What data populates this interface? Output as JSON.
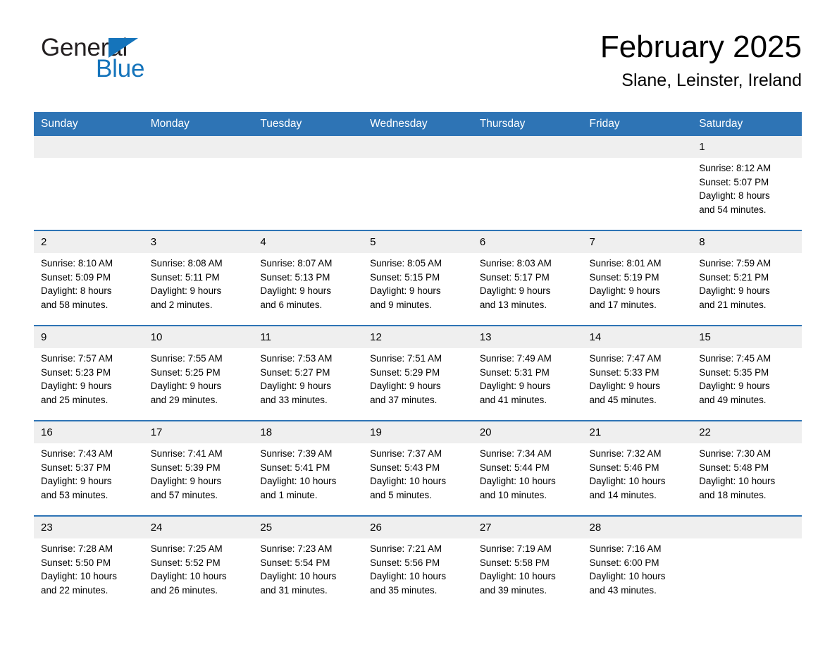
{
  "logo": {
    "word_one": "General",
    "word_two": "Blue",
    "triangle_icon": "triangle-right-icon",
    "black_color": "#231f20",
    "blue_color": "#1574bb"
  },
  "header": {
    "title": "February 2025",
    "subtitle": "Slane, Leinster, Ireland"
  },
  "theme": {
    "header_blue": "#2e74b5",
    "day_band_gray": "#efefef",
    "text_color": "#000000"
  },
  "calendar": {
    "weekday_headers": [
      "Sunday",
      "Monday",
      "Tuesday",
      "Wednesday",
      "Thursday",
      "Friday",
      "Saturday"
    ],
    "weeks": [
      [
        {
          "day": "",
          "empty": true,
          "sunrise": "",
          "sunset": "",
          "daylight_line1": "",
          "daylight_line2": ""
        },
        {
          "day": "",
          "empty": true,
          "sunrise": "",
          "sunset": "",
          "daylight_line1": "",
          "daylight_line2": ""
        },
        {
          "day": "",
          "empty": true,
          "sunrise": "",
          "sunset": "",
          "daylight_line1": "",
          "daylight_line2": ""
        },
        {
          "day": "",
          "empty": true,
          "sunrise": "",
          "sunset": "",
          "daylight_line1": "",
          "daylight_line2": ""
        },
        {
          "day": "",
          "empty": true,
          "sunrise": "",
          "sunset": "",
          "daylight_line1": "",
          "daylight_line2": ""
        },
        {
          "day": "",
          "empty": true,
          "sunrise": "",
          "sunset": "",
          "daylight_line1": "",
          "daylight_line2": ""
        },
        {
          "day": "1",
          "empty": false,
          "sunrise": "Sunrise: 8:12 AM",
          "sunset": "Sunset: 5:07 PM",
          "daylight_line1": "Daylight: 8 hours",
          "daylight_line2": "and 54 minutes."
        }
      ],
      [
        {
          "day": "2",
          "empty": false,
          "sunrise": "Sunrise: 8:10 AM",
          "sunset": "Sunset: 5:09 PM",
          "daylight_line1": "Daylight: 8 hours",
          "daylight_line2": "and 58 minutes."
        },
        {
          "day": "3",
          "empty": false,
          "sunrise": "Sunrise: 8:08 AM",
          "sunset": "Sunset: 5:11 PM",
          "daylight_line1": "Daylight: 9 hours",
          "daylight_line2": "and 2 minutes."
        },
        {
          "day": "4",
          "empty": false,
          "sunrise": "Sunrise: 8:07 AM",
          "sunset": "Sunset: 5:13 PM",
          "daylight_line1": "Daylight: 9 hours",
          "daylight_line2": "and 6 minutes."
        },
        {
          "day": "5",
          "empty": false,
          "sunrise": "Sunrise: 8:05 AM",
          "sunset": "Sunset: 5:15 PM",
          "daylight_line1": "Daylight: 9 hours",
          "daylight_line2": "and 9 minutes."
        },
        {
          "day": "6",
          "empty": false,
          "sunrise": "Sunrise: 8:03 AM",
          "sunset": "Sunset: 5:17 PM",
          "daylight_line1": "Daylight: 9 hours",
          "daylight_line2": "and 13 minutes."
        },
        {
          "day": "7",
          "empty": false,
          "sunrise": "Sunrise: 8:01 AM",
          "sunset": "Sunset: 5:19 PM",
          "daylight_line1": "Daylight: 9 hours",
          "daylight_line2": "and 17 minutes."
        },
        {
          "day": "8",
          "empty": false,
          "sunrise": "Sunrise: 7:59 AM",
          "sunset": "Sunset: 5:21 PM",
          "daylight_line1": "Daylight: 9 hours",
          "daylight_line2": "and 21 minutes."
        }
      ],
      [
        {
          "day": "9",
          "empty": false,
          "sunrise": "Sunrise: 7:57 AM",
          "sunset": "Sunset: 5:23 PM",
          "daylight_line1": "Daylight: 9 hours",
          "daylight_line2": "and 25 minutes."
        },
        {
          "day": "10",
          "empty": false,
          "sunrise": "Sunrise: 7:55 AM",
          "sunset": "Sunset: 5:25 PM",
          "daylight_line1": "Daylight: 9 hours",
          "daylight_line2": "and 29 minutes."
        },
        {
          "day": "11",
          "empty": false,
          "sunrise": "Sunrise: 7:53 AM",
          "sunset": "Sunset: 5:27 PM",
          "daylight_line1": "Daylight: 9 hours",
          "daylight_line2": "and 33 minutes."
        },
        {
          "day": "12",
          "empty": false,
          "sunrise": "Sunrise: 7:51 AM",
          "sunset": "Sunset: 5:29 PM",
          "daylight_line1": "Daylight: 9 hours",
          "daylight_line2": "and 37 minutes."
        },
        {
          "day": "13",
          "empty": false,
          "sunrise": "Sunrise: 7:49 AM",
          "sunset": "Sunset: 5:31 PM",
          "daylight_line1": "Daylight: 9 hours",
          "daylight_line2": "and 41 minutes."
        },
        {
          "day": "14",
          "empty": false,
          "sunrise": "Sunrise: 7:47 AM",
          "sunset": "Sunset: 5:33 PM",
          "daylight_line1": "Daylight: 9 hours",
          "daylight_line2": "and 45 minutes."
        },
        {
          "day": "15",
          "empty": false,
          "sunrise": "Sunrise: 7:45 AM",
          "sunset": "Sunset: 5:35 PM",
          "daylight_line1": "Daylight: 9 hours",
          "daylight_line2": "and 49 minutes."
        }
      ],
      [
        {
          "day": "16",
          "empty": false,
          "sunrise": "Sunrise: 7:43 AM",
          "sunset": "Sunset: 5:37 PM",
          "daylight_line1": "Daylight: 9 hours",
          "daylight_line2": "and 53 minutes."
        },
        {
          "day": "17",
          "empty": false,
          "sunrise": "Sunrise: 7:41 AM",
          "sunset": "Sunset: 5:39 PM",
          "daylight_line1": "Daylight: 9 hours",
          "daylight_line2": "and 57 minutes."
        },
        {
          "day": "18",
          "empty": false,
          "sunrise": "Sunrise: 7:39 AM",
          "sunset": "Sunset: 5:41 PM",
          "daylight_line1": "Daylight: 10 hours",
          "daylight_line2": "and 1 minute."
        },
        {
          "day": "19",
          "empty": false,
          "sunrise": "Sunrise: 7:37 AM",
          "sunset": "Sunset: 5:43 PM",
          "daylight_line1": "Daylight: 10 hours",
          "daylight_line2": "and 5 minutes."
        },
        {
          "day": "20",
          "empty": false,
          "sunrise": "Sunrise: 7:34 AM",
          "sunset": "Sunset: 5:44 PM",
          "daylight_line1": "Daylight: 10 hours",
          "daylight_line2": "and 10 minutes."
        },
        {
          "day": "21",
          "empty": false,
          "sunrise": "Sunrise: 7:32 AM",
          "sunset": "Sunset: 5:46 PM",
          "daylight_line1": "Daylight: 10 hours",
          "daylight_line2": "and 14 minutes."
        },
        {
          "day": "22",
          "empty": false,
          "sunrise": "Sunrise: 7:30 AM",
          "sunset": "Sunset: 5:48 PM",
          "daylight_line1": "Daylight: 10 hours",
          "daylight_line2": "and 18 minutes."
        }
      ],
      [
        {
          "day": "23",
          "empty": false,
          "sunrise": "Sunrise: 7:28 AM",
          "sunset": "Sunset: 5:50 PM",
          "daylight_line1": "Daylight: 10 hours",
          "daylight_line2": "and 22 minutes."
        },
        {
          "day": "24",
          "empty": false,
          "sunrise": "Sunrise: 7:25 AM",
          "sunset": "Sunset: 5:52 PM",
          "daylight_line1": "Daylight: 10 hours",
          "daylight_line2": "and 26 minutes."
        },
        {
          "day": "25",
          "empty": false,
          "sunrise": "Sunrise: 7:23 AM",
          "sunset": "Sunset: 5:54 PM",
          "daylight_line1": "Daylight: 10 hours",
          "daylight_line2": "and 31 minutes."
        },
        {
          "day": "26",
          "empty": false,
          "sunrise": "Sunrise: 7:21 AM",
          "sunset": "Sunset: 5:56 PM",
          "daylight_line1": "Daylight: 10 hours",
          "daylight_line2": "and 35 minutes."
        },
        {
          "day": "27",
          "empty": false,
          "sunrise": "Sunrise: 7:19 AM",
          "sunset": "Sunset: 5:58 PM",
          "daylight_line1": "Daylight: 10 hours",
          "daylight_line2": "and 39 minutes."
        },
        {
          "day": "28",
          "empty": false,
          "sunrise": "Sunrise: 7:16 AM",
          "sunset": "Sunset: 6:00 PM",
          "daylight_line1": "Daylight: 10 hours",
          "daylight_line2": "and 43 minutes."
        },
        {
          "day": "",
          "empty": true,
          "sunrise": "",
          "sunset": "",
          "daylight_line1": "",
          "daylight_line2": ""
        }
      ]
    ]
  }
}
